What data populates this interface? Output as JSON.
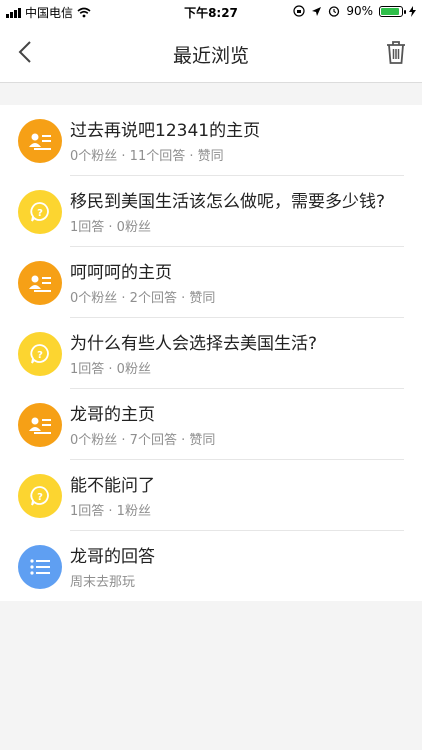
{
  "status": {
    "carrier": "中国电信",
    "time": "下午8:27",
    "battery": "90%",
    "battery_level": 0.9
  },
  "nav": {
    "title": "最近浏览"
  },
  "items": [
    {
      "title": "过去再说吧12341的主页",
      "sub": "0个粉丝 · 11个回答 · 赞同",
      "icon": "profile-card-icon",
      "color": "#f6a016"
    },
    {
      "title": "移民到美国生活该怎么做呢，需要多少钱?",
      "sub": "1回答 · 0粉丝",
      "icon": "question-icon",
      "color": "#fcd530"
    },
    {
      "title": "呵呵呵的主页",
      "sub": "0个粉丝 · 2个回答 · 赞同",
      "icon": "profile-card-icon",
      "color": "#f6a016"
    },
    {
      "title": "为什么有些人会选择去美国生活?",
      "sub": "1回答 · 0粉丝",
      "icon": "question-icon",
      "color": "#fcd530"
    },
    {
      "title": "龙哥的主页",
      "sub": "0个粉丝 · 7个回答 · 赞同",
      "icon": "profile-card-icon",
      "color": "#f6a016"
    },
    {
      "title": "能不能问了",
      "sub": "1回答 · 1粉丝",
      "icon": "question-icon",
      "color": "#fcd530"
    },
    {
      "title": "龙哥的回答",
      "sub": "周末去那玩",
      "icon": "list-icon",
      "color": "#5f9ff2"
    }
  ]
}
